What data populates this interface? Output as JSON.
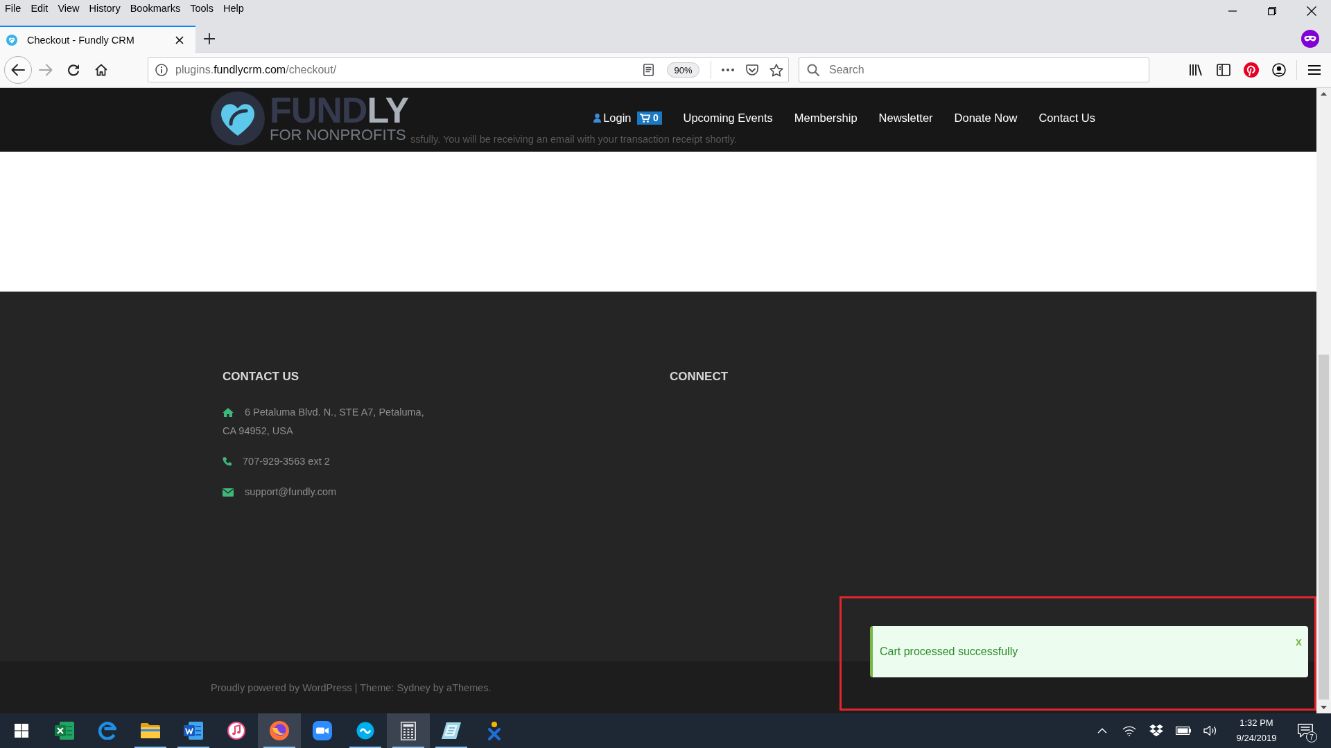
{
  "menu_bar": [
    "File",
    "Edit",
    "View",
    "History",
    "Bookmarks",
    "Tools",
    "Help"
  ],
  "tabs": [
    {
      "title": "Checkout - Fundly CRM",
      "selected": true
    }
  ],
  "toolbar": {
    "buttons": [
      {
        "kind": "back",
        "disabled": false
      },
      {
        "kind": "forward",
        "disabled": true
      },
      {
        "kind": "reload",
        "disabled": false
      },
      {
        "kind": "home",
        "disabled": false
      }
    ],
    "url": {
      "prefix": "plugins.",
      "domain": "fundlycrm.com",
      "path": "/checkout/"
    },
    "zoom": "90%",
    "search": {
      "placeholder": "Search"
    }
  },
  "header": {
    "logo": {
      "word_start": "FUND",
      "word_end": "LY",
      "tagline": "FOR NONPROFITS"
    },
    "underlying_text": "ssfully. You will be receiving an email with your transaction receipt shortly.",
    "nav": [
      {
        "kind": "login",
        "label": "Login"
      },
      {
        "kind": "cart",
        "label": "0"
      },
      {
        "kind": "link",
        "label": "Upcoming Events"
      },
      {
        "kind": "link",
        "label": "Membership"
      },
      {
        "kind": "link",
        "label": "Newsletter"
      },
      {
        "kind": "link",
        "label": "Donate Now"
      },
      {
        "kind": "link",
        "label": "Contact Us"
      }
    ]
  },
  "footer": {
    "columns": [
      {
        "title": "CONTACT US",
        "items": [
          {
            "kind": "address",
            "lines": [
              "6 Petaluma Blvd. N., STE A7, Petaluma,",
              "CA 94952, USA"
            ]
          },
          {
            "kind": "phone",
            "lines": [
              "707-929-3563 ext 2"
            ]
          },
          {
            "kind": "email",
            "lines": [
              "support@fundly.com"
            ]
          }
        ]
      },
      {
        "title": "CONNECT"
      }
    ],
    "site_info": "Proudly powered by WordPress | Theme: Sydney by aThemes."
  },
  "notice": {
    "kind": "success",
    "message": "Cart processed successfully",
    "close_label": "x",
    "highlighted": true
  },
  "taskbar": {
    "apps": [
      {
        "kind": "excel",
        "running": false,
        "highlighted": false
      },
      {
        "kind": "edge",
        "running": false,
        "highlighted": false
      },
      {
        "kind": "explorer",
        "running": true,
        "highlighted": false
      },
      {
        "kind": "word",
        "running": true,
        "highlighted": false
      },
      {
        "kind": "itunes",
        "running": false,
        "highlighted": false
      },
      {
        "kind": "firefox",
        "running": true,
        "highlighted": true
      },
      {
        "kind": "zoom",
        "running": false,
        "highlighted": false
      },
      {
        "kind": "skype",
        "running": true,
        "highlighted": false
      },
      {
        "kind": "calculator",
        "running": true,
        "highlighted": true
      },
      {
        "kind": "notes",
        "running": true,
        "highlighted": false
      },
      {
        "kind": "figure",
        "running": false,
        "highlighted": false
      }
    ],
    "tray": {
      "time": "1:32 PM",
      "date": "9/24/2019",
      "notification_count": "7"
    }
  }
}
